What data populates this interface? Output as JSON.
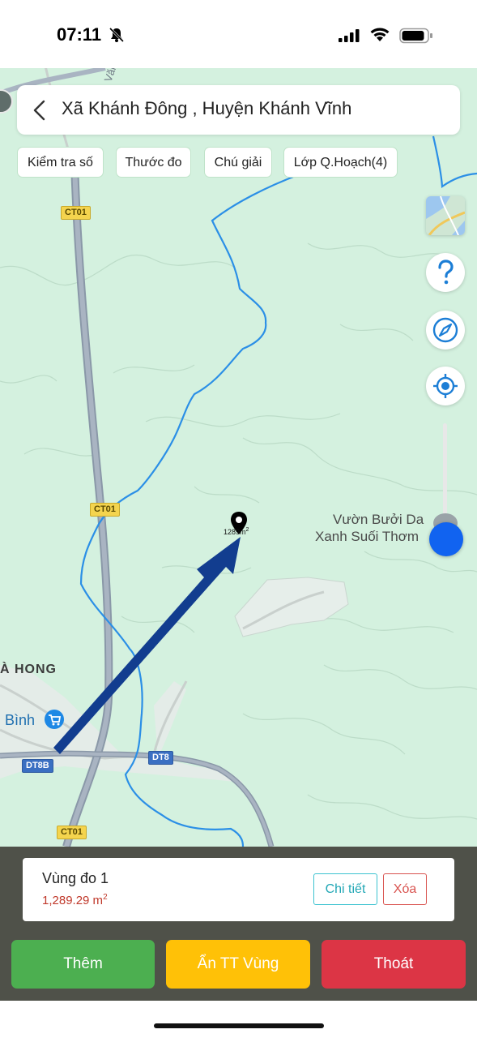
{
  "status_bar": {
    "time": "07:11"
  },
  "header": {
    "title": "Xã Khánh Đông , Huyện Khánh Vĩnh"
  },
  "chips": [
    {
      "label": "Kiểm tra số"
    },
    {
      "label": "Thước đo"
    },
    {
      "label": "Chú giải"
    },
    {
      "label": "Lớp Q.Hoạch(4)"
    }
  ],
  "map": {
    "labels": {
      "poi_line1": "Vườn Bưởi Da",
      "poi_line2": "Xanh Suối Thơm",
      "village": "À HONG",
      "town": "Bình",
      "road_top": "Văn"
    },
    "shields": {
      "ct01": "CT01",
      "dt8b": "DT8B",
      "dt8": "DT8"
    },
    "measure_value": "1289",
    "measure_unit": "m",
    "measure_sup": "2"
  },
  "zoom": {
    "level": 0.85
  },
  "panel": {
    "area_name": "Vùng đo 1",
    "area_value": "1,289.29 m",
    "area_unit_sup": "2",
    "detail_label": "Chi tiết",
    "delete_label": "Xóa"
  },
  "actions": {
    "add_label": "Thêm",
    "hide_label": "Ẩn TT Vùng",
    "exit_label": "Thoát"
  },
  "colors": {
    "map_bg": "#d4f1df",
    "boundary": "#2b8fe6",
    "add": "#4caf50",
    "hide": "#ffc107",
    "exit": "#dc3545",
    "zoom_knob": "#1163f0",
    "arrow": "#123d8f"
  },
  "icons": {
    "back": "chevron-left-icon",
    "help": "question-icon",
    "compass": "compass-icon",
    "locate": "locate-icon",
    "layers": "map-layer-icon",
    "marker": "map-pin-icon"
  }
}
